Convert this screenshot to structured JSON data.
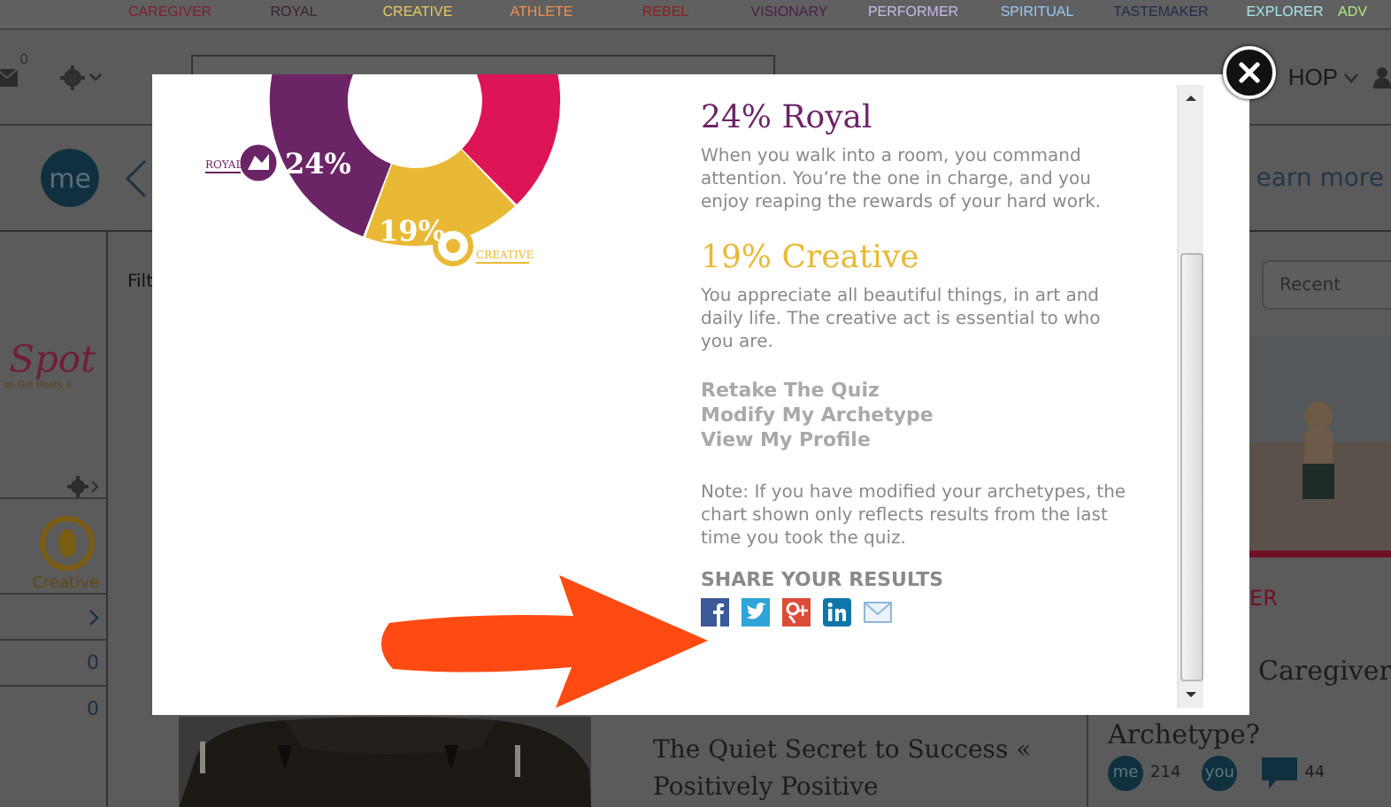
{
  "archetype_nav": [
    {
      "label": "CAREGIVER",
      "color": "#7e1f30"
    },
    {
      "label": "ROYAL",
      "color": "#3b2136"
    },
    {
      "label": "CREATIVE",
      "color": "#e8c860"
    },
    {
      "label": "ATHLETE",
      "color": "#f09050"
    },
    {
      "label": "REBEL",
      "color": "#86201f"
    },
    {
      "label": "VISIONARY",
      "color": "#4a2148"
    },
    {
      "label": "PERFORMER",
      "color": "#c8b8e8"
    },
    {
      "label": "SPIRITUAL",
      "color": "#98c8f4"
    },
    {
      "label": "TASTEMAKER",
      "color": "#1f2b4a"
    },
    {
      "label": "EXPLORER",
      "color": "#a8e4e4"
    },
    {
      "label": "ADV",
      "color": "#b0e880"
    }
  ],
  "toolbar": {
    "mail_count": "0",
    "menu_label": "HOP"
  },
  "header": {
    "logo": "me",
    "link": "earn more"
  },
  "left_panel": {
    "logo": "Spot",
    "tagline": "en Girl Meets 3",
    "archetype": "Creative",
    "rows": [
      {
        "kind": "chevron"
      },
      {
        "kind": "count",
        "value": "0"
      },
      {
        "kind": "count",
        "value": "0"
      }
    ]
  },
  "filter_label": "Filt",
  "article": {
    "title": "The Quiet Secret to Success « Positively Positive"
  },
  "right_panel": {
    "sort": "Recent",
    "tag": "ER",
    "title_end": "Caregiver",
    "title_line2": "Archetype?",
    "me_badge": "me",
    "me_count": "214",
    "you_badge": "you",
    "comment_count": "44"
  },
  "modal": {
    "chart_labels": {
      "royal_name": "ROYAL",
      "royal_pct": "24%",
      "creative_pct": "19%",
      "creative_name": "CREATIVE"
    },
    "results": [
      {
        "title": "24% Royal",
        "color": "#6b2566",
        "text": "When you walk into a room, you command attention. You’re the one in charge, and you enjoy reaping the rewards of your hard work."
      },
      {
        "title": "19% Creative",
        "color": "#e9b935",
        "text": "You appreciate all beautiful things, in art and daily life. The creative act is essential to who you are."
      }
    ],
    "links": [
      "Retake The Quiz",
      "Modify My Archetype",
      "View My Profile"
    ],
    "note": "Note: If you have modified your archetypes, the chart shown only reflects results from the last time you took the quiz.",
    "share_heading": "SHARE YOUR RESULTS",
    "share": [
      {
        "kind": "facebook"
      },
      {
        "kind": "twitter"
      },
      {
        "kind": "googleplus"
      },
      {
        "kind": "linkedin"
      },
      {
        "kind": "mail"
      }
    ]
  }
}
